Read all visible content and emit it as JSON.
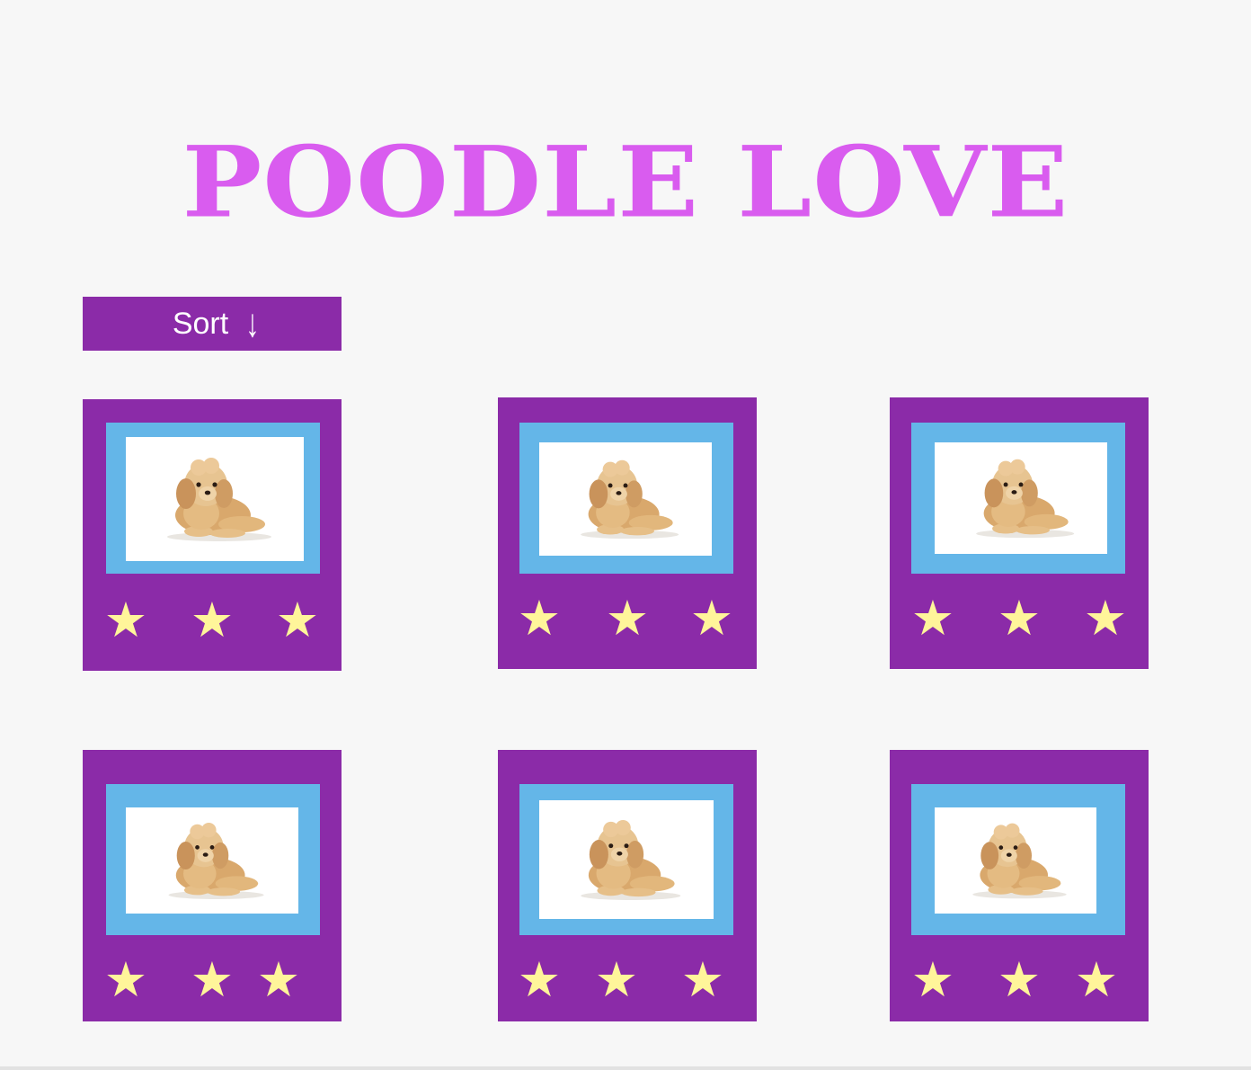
{
  "header": {
    "title": "POODLE LOVE"
  },
  "toolbar": {
    "sort_label": "Sort",
    "sort_icon": "arrow-down-icon",
    "sort_arrow": "↓"
  },
  "colors": {
    "background": "#f7f7f7",
    "title": "#d95cef",
    "card": "#8b2ba8",
    "frame": "#64b6e8",
    "star": "#fff59a"
  },
  "cards": [
    {
      "image": "poodle-puppy-photo",
      "rating": 3,
      "stars": [
        "★",
        "★",
        "★"
      ]
    },
    {
      "image": "poodle-puppy-photo",
      "rating": 3,
      "stars": [
        "★",
        "★",
        "★"
      ]
    },
    {
      "image": "poodle-puppy-photo",
      "rating": 3,
      "stars": [
        "★",
        "★",
        "★"
      ]
    },
    {
      "image": "poodle-puppy-photo",
      "rating": 3,
      "stars": [
        "★",
        "★",
        "★"
      ]
    },
    {
      "image": "poodle-puppy-photo",
      "rating": 3,
      "stars": [
        "★",
        "★",
        "★"
      ]
    },
    {
      "image": "poodle-puppy-photo",
      "rating": 3,
      "stars": [
        "★",
        "★",
        "★"
      ]
    }
  ]
}
